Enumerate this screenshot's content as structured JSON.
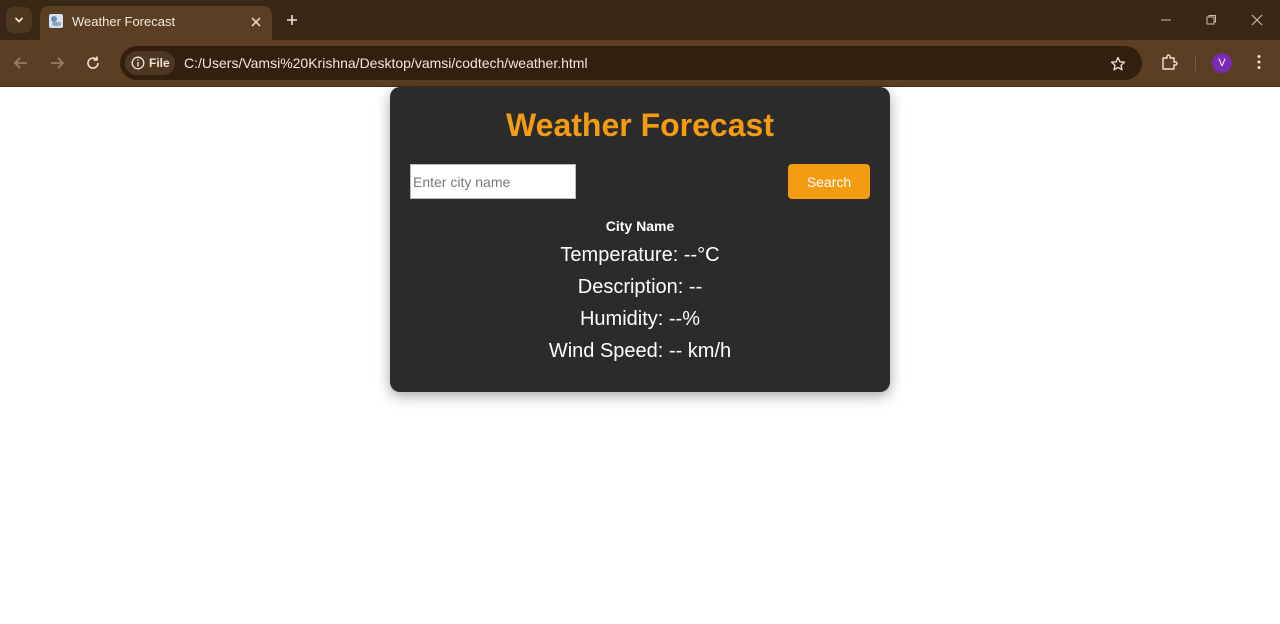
{
  "browser": {
    "tab_title": "Weather Forecast",
    "file_chip": "File",
    "url": "C:/Users/Vamsi%20Krishna/Desktop/vamsi/codtech/weather.html",
    "profile_initial": "V",
    "colors": {
      "frame": "#3a2816",
      "toolbar": "#5b3f24",
      "omnibox": "#331f0d",
      "avatar": "#7a2bb3"
    }
  },
  "page": {
    "title": "Weather Forecast",
    "search": {
      "placeholder": "Enter city name",
      "value": "",
      "button_label": "Search"
    },
    "city_name": "City Name",
    "stats": {
      "temperature": "Temperature: --°C",
      "description": "Description: --",
      "humidity": "Humidity: --%",
      "wind_speed": "Wind Speed: -- km/h"
    },
    "colors": {
      "card_bg": "#2b2b2b",
      "accent": "#f39c12",
      "text": "#ffffff"
    }
  }
}
